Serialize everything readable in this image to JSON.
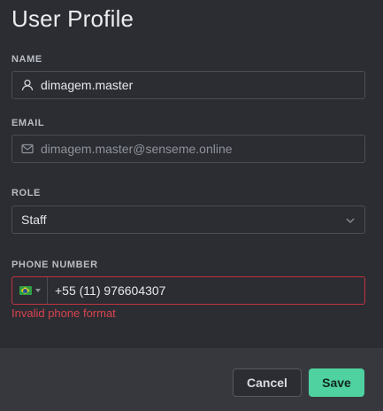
{
  "dialog": {
    "title": "User Profile"
  },
  "form": {
    "name": {
      "label": "NAME",
      "value": "dimagem.master",
      "icon": "user-icon"
    },
    "email": {
      "label": "EMAIL",
      "value": "dimagem.master@senseme.online",
      "icon": "mail-icon"
    },
    "role": {
      "label": "ROLE",
      "value": "Staff",
      "icon": "chevron-down-icon"
    },
    "phone": {
      "label": "PHONE NUMBER",
      "country_flag": "brazil-flag-icon",
      "value": "+55 (11) 976604307",
      "error": "Invalid phone format"
    }
  },
  "footer": {
    "cancel_label": "Cancel",
    "save_label": "Save"
  },
  "colors": {
    "background": "#2b2d33",
    "footer_bg": "#36383e",
    "accent": "#4fd1a0",
    "error": "#d8434e"
  }
}
